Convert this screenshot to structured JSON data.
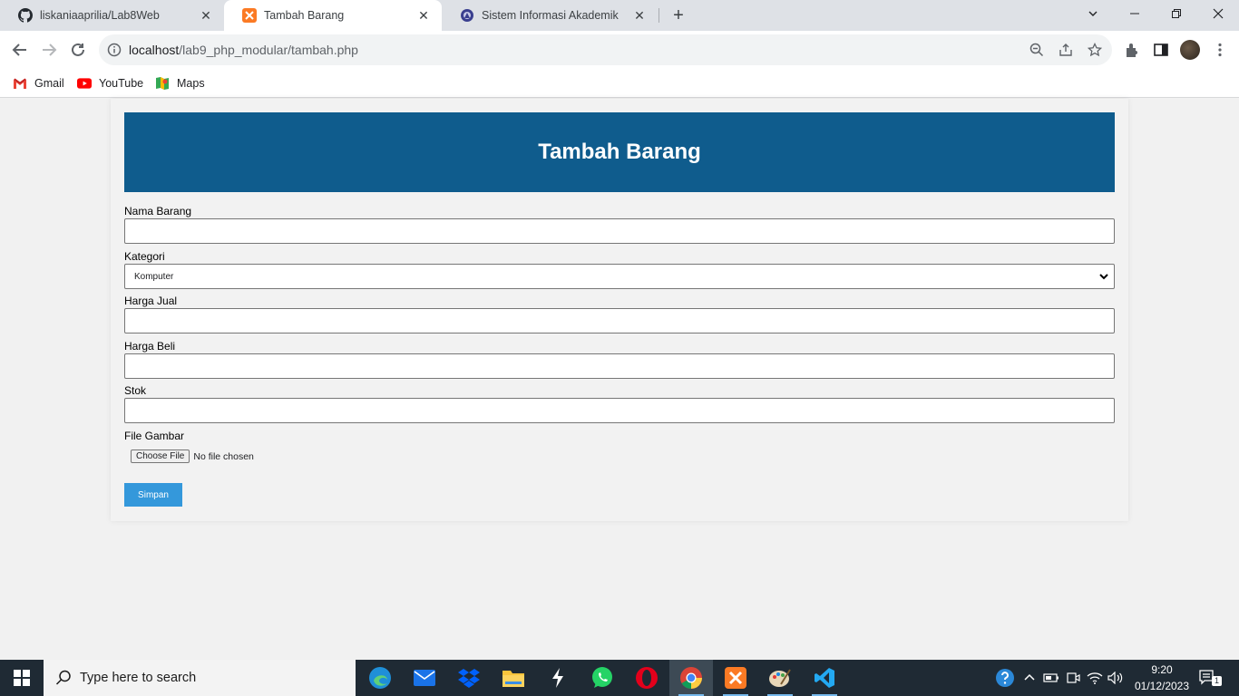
{
  "browser": {
    "tabs": [
      {
        "title": "liskaniaaprilia/Lab8Web",
        "icon": "github-icon"
      },
      {
        "title": "Tambah Barang",
        "icon": "xampp-icon",
        "active": true
      },
      {
        "title": "Sistem Informasi Akademik",
        "icon": "university-icon"
      }
    ],
    "url_host": "localhost",
    "url_path": "/lab9_php_modular/tambah.php",
    "bookmarks": [
      {
        "label": "Gmail",
        "icon": "gmail-icon"
      },
      {
        "label": "YouTube",
        "icon": "youtube-icon"
      },
      {
        "label": "Maps",
        "icon": "maps-icon"
      }
    ]
  },
  "page": {
    "title": "Tambah Barang",
    "form": {
      "nama_label": "Nama Barang",
      "kategori_label": "Kategori",
      "kategori_selected": "Komputer",
      "harga_jual_label": "Harga Jual",
      "harga_beli_label": "Harga Beli",
      "stok_label": "Stok",
      "file_label": "File Gambar",
      "file_button": "Choose File",
      "file_status": "No file chosen",
      "submit_label": "Simpan"
    },
    "colors": {
      "header": "#0f5c8d",
      "submit": "#3498db"
    }
  },
  "taskbar": {
    "search_placeholder": "Type here to search",
    "time": "9:20",
    "date": "01/12/2023",
    "notification_count": "1",
    "apps": [
      "edge-icon",
      "mail-icon",
      "dropbox-icon",
      "file-explorer-icon",
      "app-s-icon",
      "whatsapp-icon",
      "opera-icon",
      "chrome-icon",
      "xampp-icon",
      "paint-icon",
      "vscode-icon"
    ]
  }
}
